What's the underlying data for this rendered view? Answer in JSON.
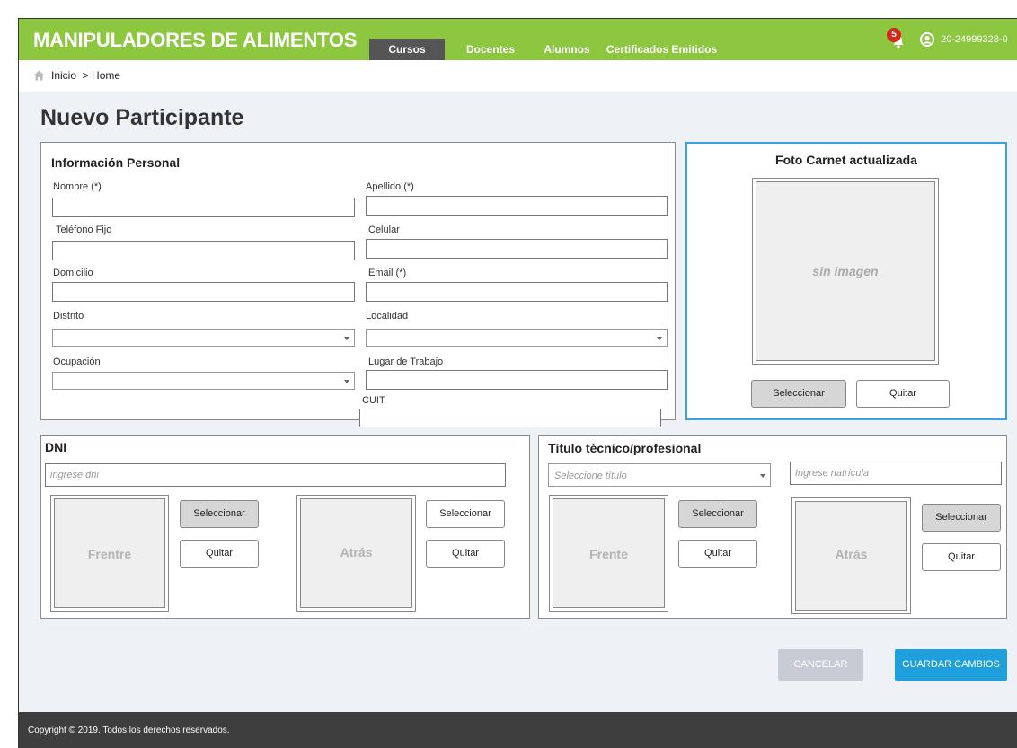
{
  "header": {
    "brand": "MANIPULADORES DE ALIMENTOS",
    "nav": [
      "Cursos",
      "Docentes",
      "Alumnos",
      "Certificados Emitidos"
    ],
    "notifications": "5",
    "user_id": "20-24999328-0"
  },
  "breadcrumb": "Inicio  > Home",
  "page_title": "Nuevo Participante",
  "personal": {
    "title": "Información Personal",
    "nombre": "Nombre (*)",
    "apellido": "Apellido (*)",
    "telefono": "Teléfono Fijo",
    "celular": "Celular",
    "domicilio": "Domicilio",
    "email": "Email (*)",
    "distrito": "Distrito",
    "localidad": "Localidad",
    "ocupacion": "Ocupación",
    "lugar": "Lugar de Trabajo",
    "cuit": "CUIT"
  },
  "photo": {
    "title": "Foto Carnet actualizada",
    "placeholder": "sin imagen",
    "select": "Seleccionar",
    "remove": "Quitar"
  },
  "dni": {
    "title": "DNI",
    "placeholder": "ingrese dni",
    "front": "Frentre",
    "back": "Atrás",
    "select": "Seleccionar",
    "remove": "Quitar"
  },
  "title_section": {
    "title": "Título técnico/profesional",
    "select_placeholder": "Seleccione título",
    "matricula_placeholder": "Ingrese natrícula",
    "front": "Frente",
    "back": "Atrás",
    "select": "Seleccionar",
    "remove": "Quitar"
  },
  "actions": {
    "cancel": "CANCELAR",
    "save": "GUARDAR CAMBIOS"
  },
  "footer": "Copyright © 2019. Todos los derechos reservados.",
  "colors": {
    "brand_green": "#8dc63f",
    "accent_blue": "#1fa0dc",
    "footer": "#3e3e3e"
  }
}
